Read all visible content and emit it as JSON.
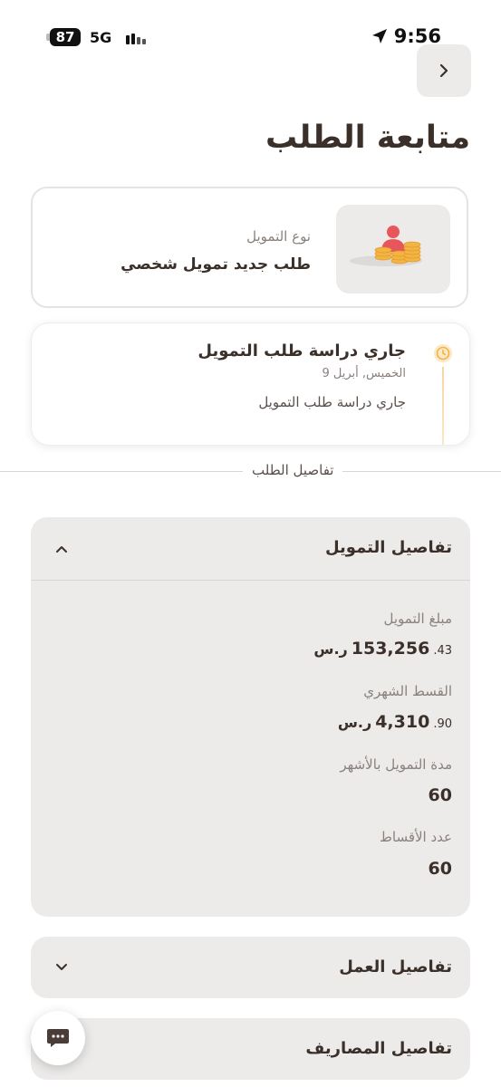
{
  "status_bar": {
    "battery": "87",
    "network": "5G",
    "time": "9:56"
  },
  "header": {
    "title": "متابعة الطلب"
  },
  "finance_type": {
    "label": "نوع التمويل",
    "value": "طلب جديد تمويل شخصي"
  },
  "status_card": {
    "title": "جاري دراسة طلب التمويل",
    "date": "الخميس, أبريل 9",
    "description": "جاري دراسة طلب التمويل",
    "accent_color": "#f2b443"
  },
  "details_section": {
    "label": "تفاصيل الطلب"
  },
  "finance_details": {
    "title": "تفاصيل التمويل",
    "fields": [
      {
        "label": "مبلغ التمويل",
        "whole": "153,256",
        "decimal": ".43",
        "currency": "ر.س"
      },
      {
        "label": "القسط الشهري",
        "whole": "4,310",
        "decimal": ".90",
        "currency": "ر.س"
      },
      {
        "label": "مدة التمويل بالأشهر",
        "whole": "60",
        "decimal": "",
        "currency": ""
      },
      {
        "label": "عدد الأقساط",
        "whole": "60",
        "decimal": "",
        "currency": ""
      }
    ]
  },
  "work_details": {
    "title": "تفاصيل العمل"
  },
  "expenses_details": {
    "title": "تفاصيل المصاريف"
  },
  "icons": [
    "chevron-right-icon",
    "location-arrow-icon",
    "clock-icon",
    "chevron-up-icon",
    "chevron-down-icon",
    "chat-icon",
    "money-person-icon"
  ]
}
